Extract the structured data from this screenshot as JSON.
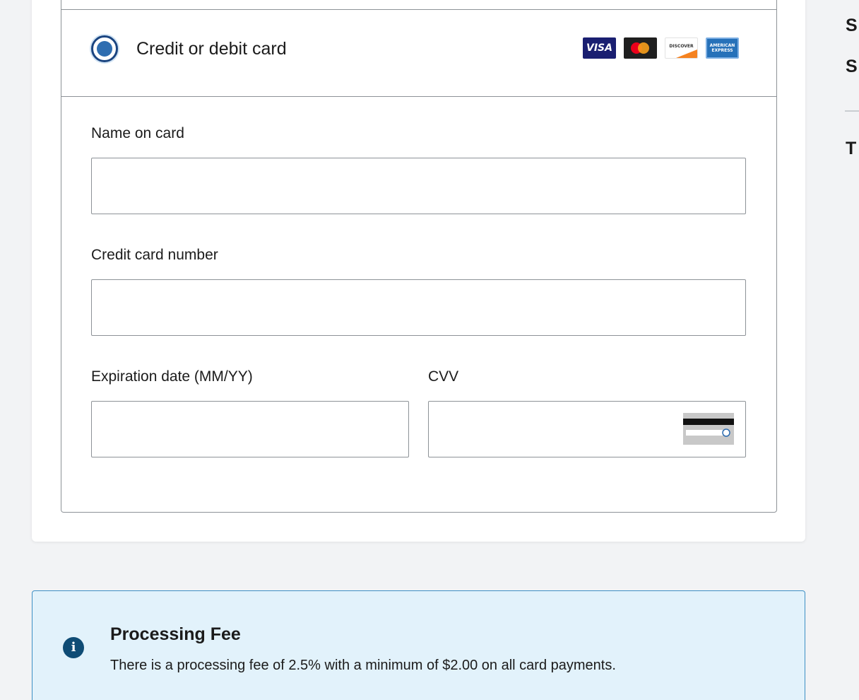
{
  "payment": {
    "method_label": "Credit or debit card",
    "selected": true,
    "brands": [
      {
        "name": "visa",
        "text": "VISA"
      },
      {
        "name": "mastercard",
        "text": ""
      },
      {
        "name": "discover",
        "text": "DISCOVER"
      },
      {
        "name": "amex",
        "text": "AMERICAN EXPRESS"
      }
    ]
  },
  "form": {
    "name_label": "Name on card",
    "name_value": "",
    "number_label": "Credit card number",
    "number_value": "",
    "expiry_label": "Expiration date (MM/YY)",
    "expiry_value": "",
    "cvv_label": "CVV",
    "cvv_value": ""
  },
  "alert": {
    "icon": "info-icon",
    "title": "Processing Fee",
    "body": "There is a processing fee of 2.5% with a minimum of $2.00 on all card payments."
  },
  "summary": {
    "partial_lines": [
      "S",
      "S",
      "T"
    ]
  },
  "colors": {
    "page_bg": "#f2f3f5",
    "radio_accent": "#2e6db0",
    "alert_bg": "#e2f2fb",
    "alert_border": "#3d8fc4",
    "alert_icon": "#0f4c75"
  }
}
